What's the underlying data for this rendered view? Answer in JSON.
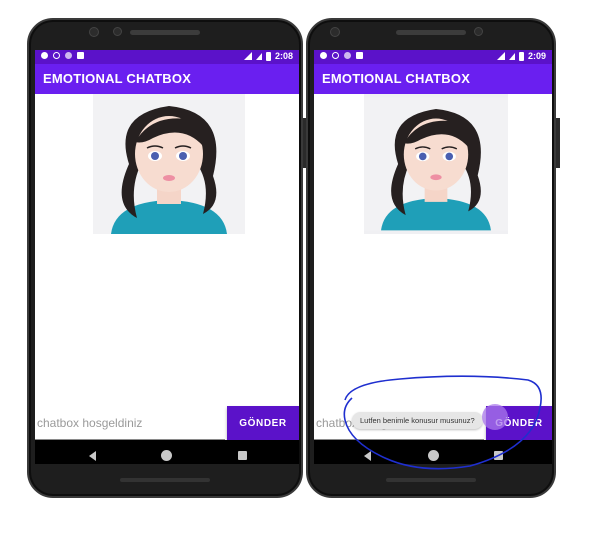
{
  "app": {
    "title": "EMOTIONAL CHATBOX",
    "brand_color": "#6a1ff0",
    "status_color": "#5b12c9"
  },
  "screens": [
    {
      "status_time": "2:08",
      "input": {
        "value": "chatbox hosgeldiniz",
        "placeholder": ""
      },
      "send_label": "GÖNDER"
    },
    {
      "status_time": "2:09",
      "input": {
        "value": "chatbox hosgeldiniz",
        "placeholder": ""
      },
      "send_label": "GÖNDER",
      "toast": "Lutfen benimle konusur musunuz?",
      "annotation_color": "#1f2fcf"
    }
  ],
  "icons": {
    "status_left": [
      "gear-icon",
      "shield-icon",
      "circle-icon",
      "sd-card-icon"
    ],
    "status_right": [
      "wifi-icon",
      "signal-icon",
      "battery-icon"
    ],
    "nav": [
      "back-icon",
      "home-icon",
      "recents-icon"
    ]
  }
}
